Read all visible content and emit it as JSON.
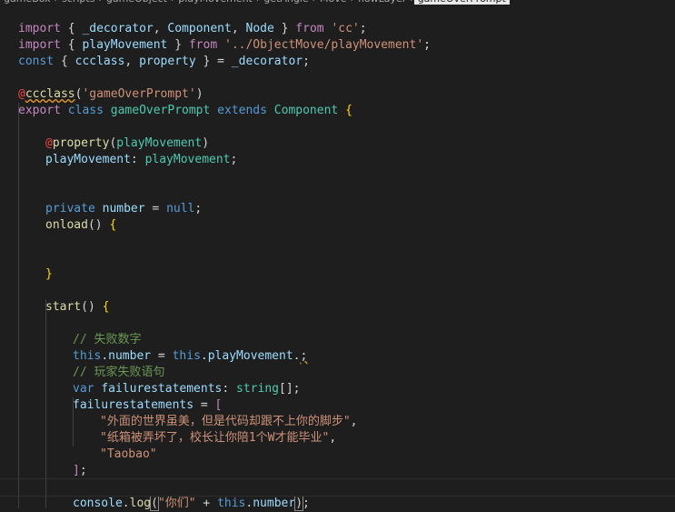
{
  "breadcrumb": {
    "items": [
      "gameBox",
      "scripts",
      "gameObject",
      "playMovement",
      "getAngle",
      "Move",
      "flowLayer",
      "gameOverPrompt"
    ],
    "separator": "›",
    "active_index": 7
  },
  "code": {
    "l1": {
      "kw1": "import",
      "p1": " { ",
      "name1": "_decorator",
      "p2": ", ",
      "name2": "Component",
      "p3": ", ",
      "name3": "Node",
      "p4": " } ",
      "kw2": "from",
      "p5": " ",
      "str": "'cc'",
      "end": ";"
    },
    "l2": {
      "kw1": "import",
      "p1": " { ",
      "name": "playMovement",
      "p2": " } ",
      "kw2": "from",
      "p3": " ",
      "str": "'../ObjectMove/playMovement'",
      "end": ";"
    },
    "l3": {
      "kw": "const",
      "p1": " { ",
      "name1": "ccclass",
      "p2": ", ",
      "name2": "property",
      "p3": " } = ",
      "name3": "_decorator",
      "end": ";"
    },
    "l5": {
      "at": "@",
      "deco": "ccclass",
      "p1": "(",
      "str": "'gameOverPrompt'",
      "p2": ")"
    },
    "l6": {
      "kw1": "export",
      "kw2": "class",
      "name": "gameOverPrompt",
      "kw3": "extends",
      "base": "Component",
      "brace": "{"
    },
    "l8": {
      "at": "@",
      "fn": "property",
      "p1": "(",
      "arg": "playMovement",
      "p2": ")"
    },
    "l9": {
      "name": "playMovement",
      "colon": ": ",
      "type": "playMovement",
      "end": ";"
    },
    "l11": {
      "kw": "private",
      "name": "number",
      "eq": " = ",
      "val": "null",
      "end": ";"
    },
    "l12": {
      "fn": "onload",
      "p": "() ",
      "brace": "{"
    },
    "l15": {
      "brace": "}"
    },
    "l17": {
      "fn": "start",
      "p": "() ",
      "brace": "{"
    },
    "l19": {
      "cmt": "// 失败数字"
    },
    "l20": {
      "this": "this",
      "d1": ".",
      "prop1": "number",
      "eq": " = ",
      "this2": "this",
      "d2": ".",
      "prop2": "playMovement",
      "d3": ".",
      "end": ";"
    },
    "l21": {
      "cmt": "// 玩家失败语句"
    },
    "l22": {
      "kw": "var",
      "name": "failurestatements",
      "colon": ": ",
      "type": "string",
      "arr": "[]",
      "end": ";"
    },
    "l23": {
      "name": "failurestatements",
      "eq": " = ",
      "bracket": "["
    },
    "l24": {
      "str": "\"外面的世界虽美，但是代码却跟不上你的脚步\"",
      "comma": ","
    },
    "l25": {
      "str": "\"纸箱被弄坏了，校长让你陪1个W才能毕业\"",
      "comma": ","
    },
    "l26": {
      "str": "\"Taobao\""
    },
    "l27": {
      "bracket": "]",
      "end": ";"
    },
    "l29": {
      "obj": "console",
      "dot": ".",
      "fn": "log",
      "p1": "(",
      "str": "\"你们\"",
      "plus": " + ",
      "this": "this",
      "d": ".",
      "prop": "number",
      "p2": ")",
      "end": ";"
    }
  }
}
